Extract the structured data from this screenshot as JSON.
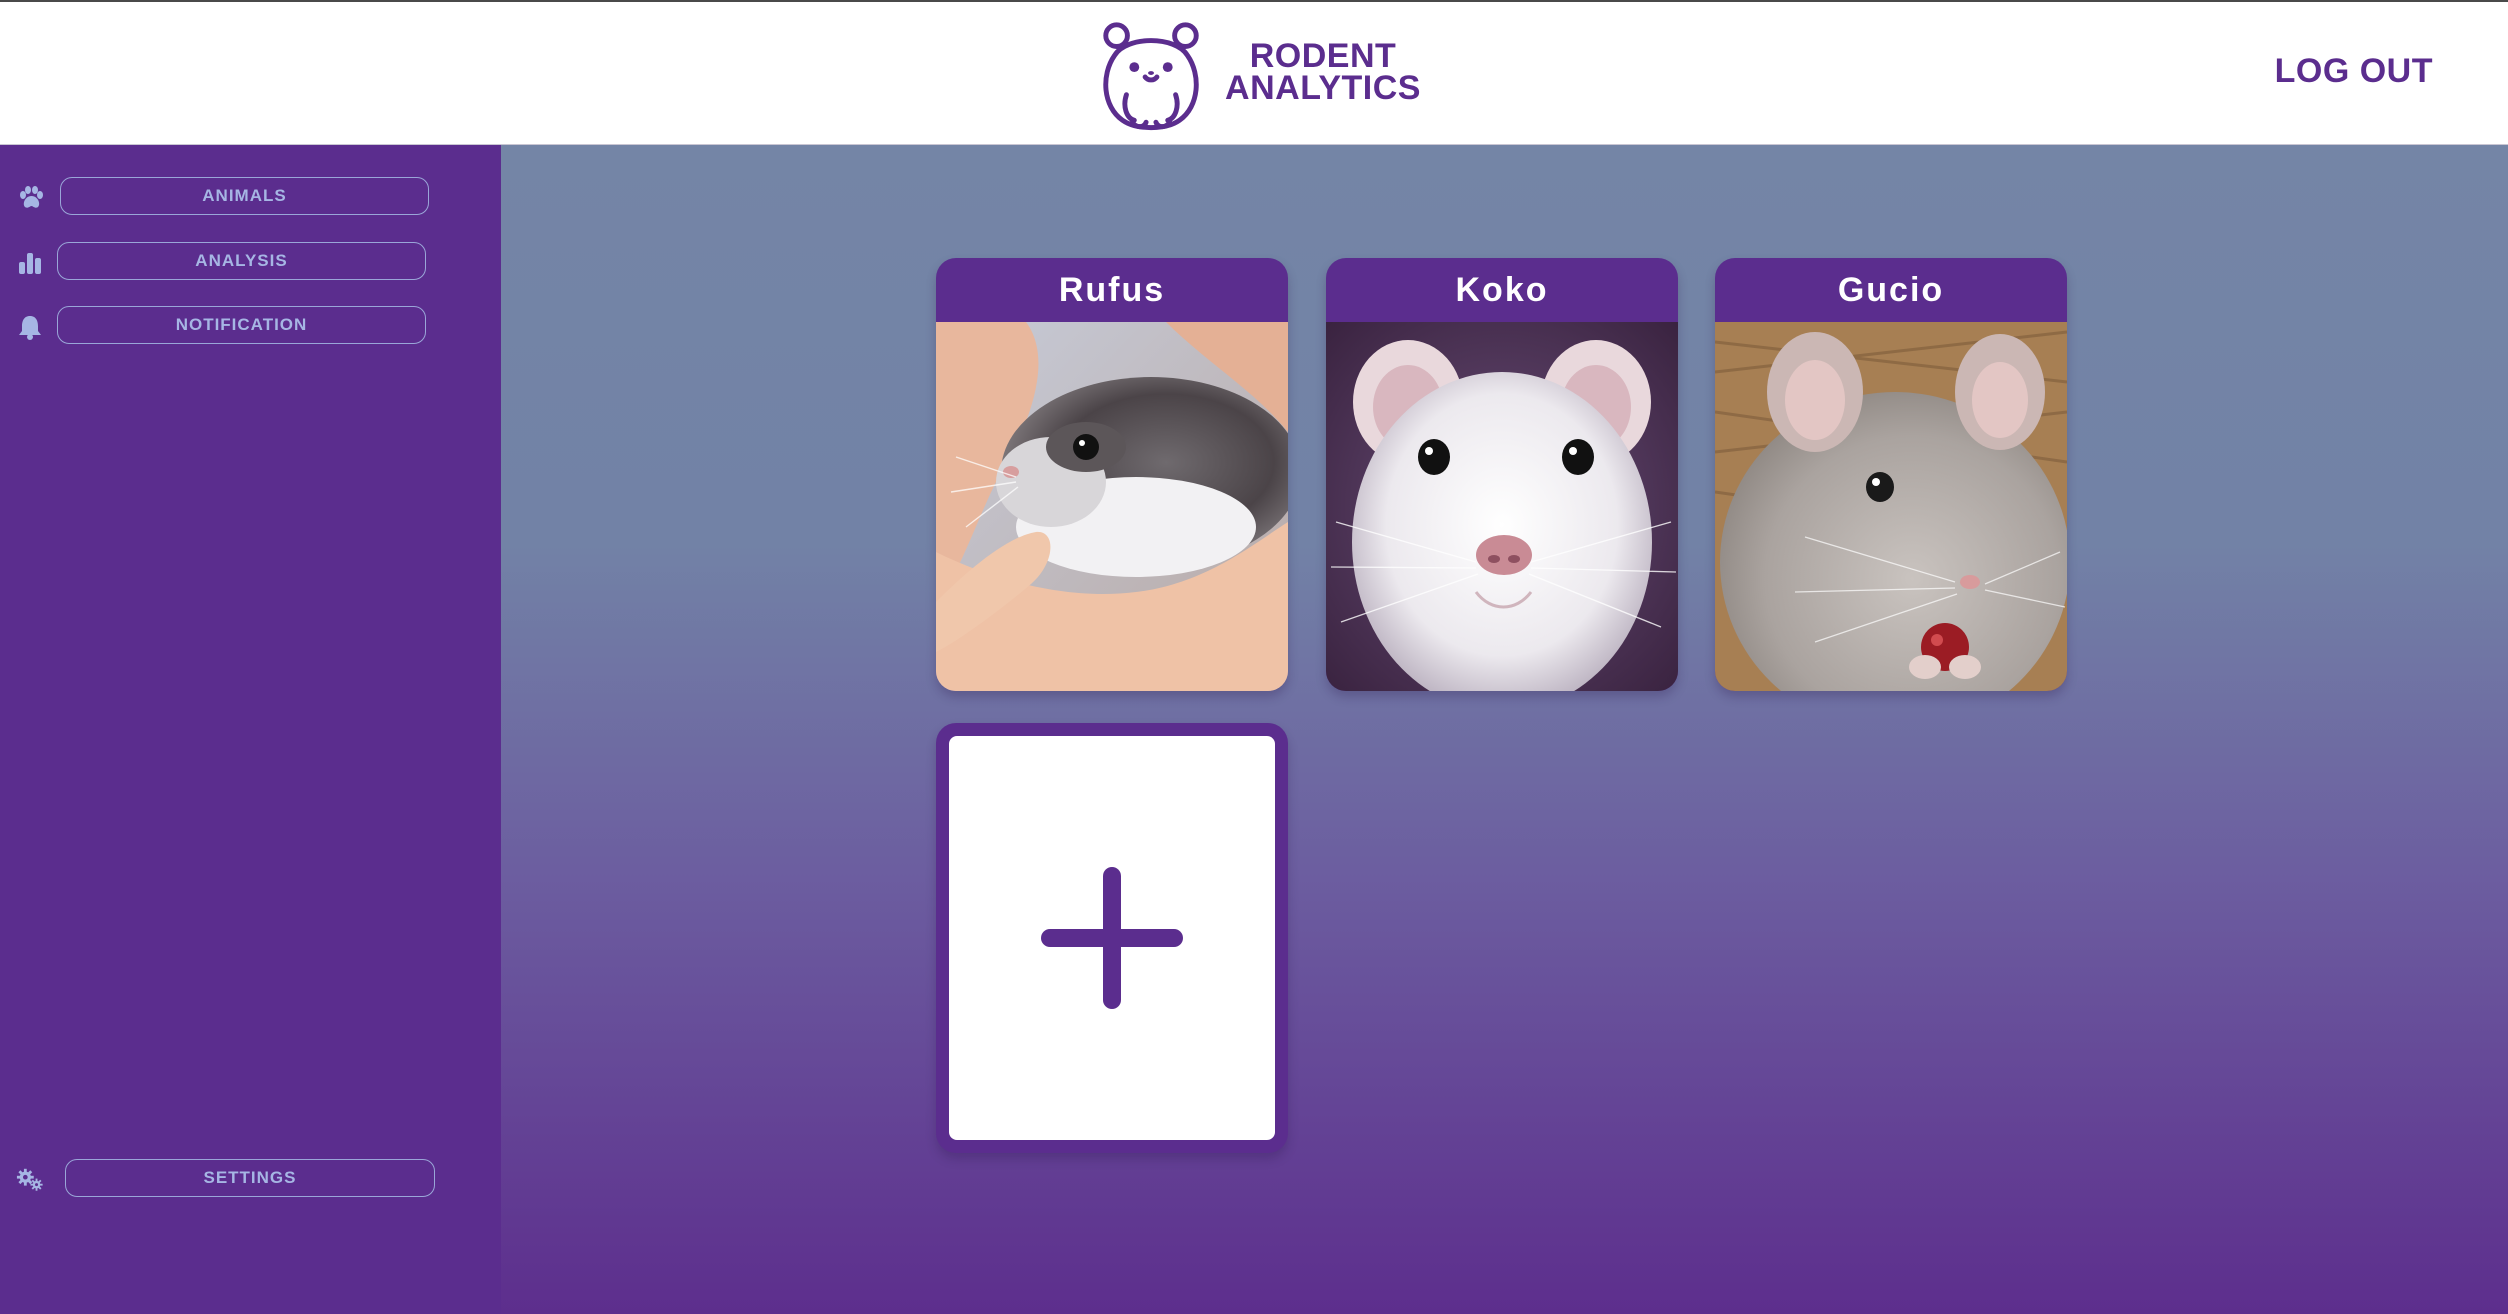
{
  "app": {
    "brand_line1": "RODENT",
    "brand_line2": "ANALYTICS",
    "logout_label": "LOG OUT"
  },
  "sidebar": {
    "items": [
      {
        "label": "ANIMALS",
        "icon": "paw-icon"
      },
      {
        "label": "ANALYSIS",
        "icon": "bar-chart-icon"
      },
      {
        "label": "NOTIFICATION",
        "icon": "bell-icon"
      }
    ],
    "settings": {
      "label": "SETTINGS",
      "icon": "gears-icon"
    }
  },
  "animals": [
    {
      "name": "Rufus",
      "photo": "hamster-in-hand"
    },
    {
      "name": "Koko",
      "photo": "white-rat"
    },
    {
      "name": "Gucio",
      "photo": "grey-chinchilla"
    }
  ],
  "add_animal": {
    "icon": "plus-icon"
  },
  "colors": {
    "brand_purple": "#5b2d8e",
    "nav_text": "#a6b6e4",
    "main_top": "#7485a6",
    "main_bottom": "#5d2e8d"
  }
}
